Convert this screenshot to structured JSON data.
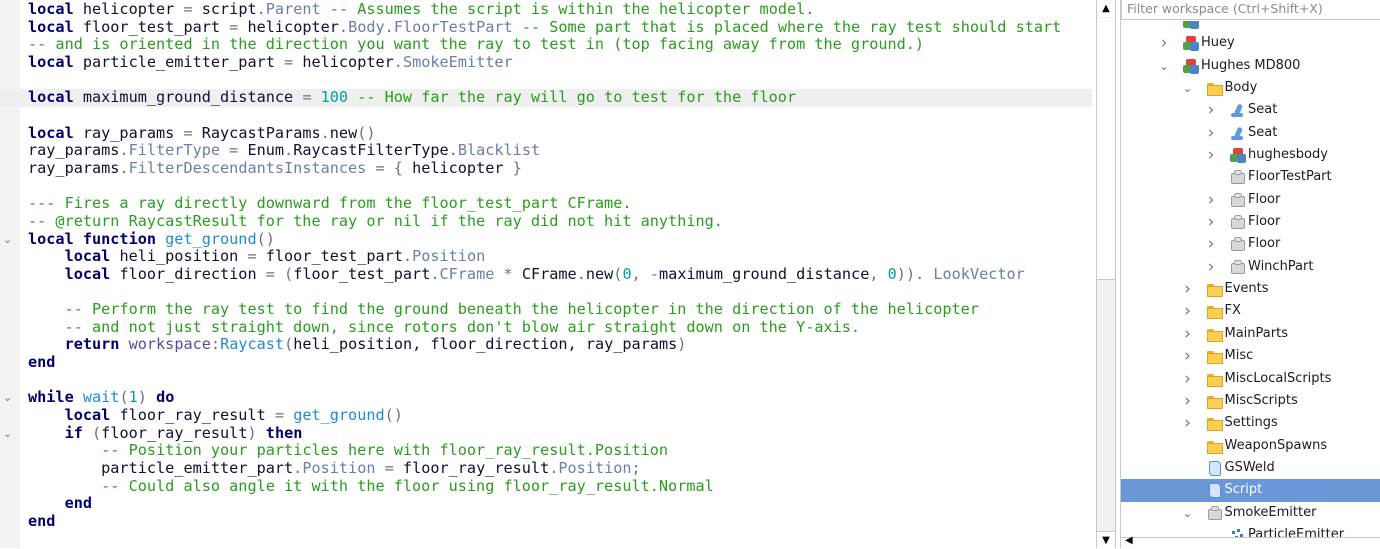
{
  "editor": {
    "highlighted_line": 6,
    "lines": [
      [
        [
          "k",
          "local"
        ],
        [
          "p",
          " helicopter "
        ],
        [
          "o",
          "="
        ],
        [
          "p",
          " script"
        ],
        [
          "o",
          "."
        ],
        [
          "m",
          "Parent"
        ],
        [
          "c",
          " -- Assumes the script is within the helicopter model."
        ]
      ],
      [
        [
          "k",
          "local"
        ],
        [
          "p",
          " floor_test_part "
        ],
        [
          "o",
          "="
        ],
        [
          "p",
          " helicopter"
        ],
        [
          "o",
          "."
        ],
        [
          "m",
          "Body"
        ],
        [
          "o",
          "."
        ],
        [
          "m",
          "FloorTestPart"
        ],
        [
          "c",
          " -- Some part that is placed where the ray test should start"
        ]
      ],
      [
        [
          "c",
          "-- and is oriented in the direction you want the ray to test in (top facing away from the ground.)"
        ]
      ],
      [
        [
          "k",
          "local"
        ],
        [
          "p",
          " particle_emitter_part "
        ],
        [
          "o",
          "="
        ],
        [
          "p",
          " helicopter"
        ],
        [
          "o",
          "."
        ],
        [
          "m",
          "SmokeEmitter"
        ]
      ],
      [],
      [
        [
          "k",
          "local"
        ],
        [
          "p",
          " maximum_ground_distance "
        ],
        [
          "o",
          "="
        ],
        [
          "n",
          " 100"
        ],
        [
          "c",
          " -- How far the ray will go to test for the floor"
        ]
      ],
      [],
      [
        [
          "k",
          "local"
        ],
        [
          "p",
          " ray_params "
        ],
        [
          "o",
          "="
        ],
        [
          "p",
          " RaycastParams"
        ],
        [
          "o",
          "."
        ],
        [
          "p",
          "new"
        ],
        [
          "o",
          "()"
        ]
      ],
      [
        [
          "p",
          "ray_params"
        ],
        [
          "o",
          "."
        ],
        [
          "m",
          "FilterType"
        ],
        [
          "o",
          " = "
        ],
        [
          "p",
          "Enum"
        ],
        [
          "o",
          "."
        ],
        [
          "p",
          "RaycastFilterType"
        ],
        [
          "o",
          "."
        ],
        [
          "m",
          "Blacklist"
        ]
      ],
      [
        [
          "p",
          "ray_params"
        ],
        [
          "o",
          "."
        ],
        [
          "m",
          "FilterDescendantsInstances"
        ],
        [
          "o",
          " = { "
        ],
        [
          "p",
          "helicopter"
        ],
        [
          "o",
          " }"
        ]
      ],
      [],
      [
        [
          "c",
          "--- Fires a ray directly downward from the floor_test_part CFrame."
        ]
      ],
      [
        [
          "c",
          "-- @return RaycastResult for the ray or nil if the ray did not hit anything."
        ]
      ],
      [
        [
          "k",
          "local function"
        ],
        [
          "f",
          " get_ground"
        ],
        [
          "o",
          "()"
        ]
      ],
      [
        [
          "p",
          "    "
        ],
        [
          "k",
          "local"
        ],
        [
          "p",
          " heli_position "
        ],
        [
          "o",
          "="
        ],
        [
          "p",
          " floor_test_part"
        ],
        [
          "o",
          "."
        ],
        [
          "m",
          "Position"
        ]
      ],
      [
        [
          "p",
          "    "
        ],
        [
          "k",
          "local"
        ],
        [
          "p",
          " floor_direction "
        ],
        [
          "o",
          "= ("
        ],
        [
          "p",
          "floor_test_part"
        ],
        [
          "o",
          "."
        ],
        [
          "m",
          "CFrame"
        ],
        [
          "o",
          " * "
        ],
        [
          "p",
          "CFrame"
        ],
        [
          "o",
          "."
        ],
        [
          "p",
          "new"
        ],
        [
          "o",
          "("
        ],
        [
          "n",
          "0"
        ],
        [
          "o",
          ", -"
        ],
        [
          "p",
          "maximum_ground_distance"
        ],
        [
          "o",
          ", "
        ],
        [
          "n",
          "0"
        ],
        [
          "o",
          ")). "
        ],
        [
          "m",
          "LookVector"
        ]
      ],
      [],
      [
        [
          "p",
          "    "
        ],
        [
          "c",
          "-- Perform the ray test to find the ground beneath the helicopter in the direction of the helicopter"
        ]
      ],
      [
        [
          "p",
          "    "
        ],
        [
          "c",
          "-- and not just straight down, since rotors don't blow air straight down on the Y-axis."
        ]
      ],
      [
        [
          "p",
          "    "
        ],
        [
          "k",
          "return"
        ],
        [
          "p",
          " "
        ],
        [
          "b",
          "workspace"
        ],
        [
          "o",
          ":"
        ],
        [
          "f",
          "Raycast"
        ],
        [
          "o",
          "("
        ],
        [
          "p",
          "heli_position, floor_direction, ray_params"
        ],
        [
          "o",
          ")"
        ]
      ],
      [
        [
          "k",
          "end"
        ]
      ],
      [],
      [
        [
          "k",
          "while"
        ],
        [
          "p",
          " "
        ],
        [
          "f",
          "wait"
        ],
        [
          "o",
          "("
        ],
        [
          "n",
          "1"
        ],
        [
          "o",
          ")"
        ],
        [
          "p",
          " "
        ],
        [
          "k",
          "do"
        ]
      ],
      [
        [
          "p",
          "    "
        ],
        [
          "k",
          "local"
        ],
        [
          "p",
          " floor_ray_result "
        ],
        [
          "o",
          "= "
        ],
        [
          "f",
          "get_ground"
        ],
        [
          "o",
          "()"
        ]
      ],
      [
        [
          "p",
          "    "
        ],
        [
          "k",
          "if"
        ],
        [
          "o",
          " ("
        ],
        [
          "p",
          "floor_ray_result"
        ],
        [
          "o",
          ")"
        ],
        [
          "p",
          " "
        ],
        [
          "k",
          "then"
        ]
      ],
      [
        [
          "p",
          "        "
        ],
        [
          "c",
          "-- Position your particles here with floor_ray_result.Position"
        ]
      ],
      [
        [
          "p",
          "        particle_emitter_part"
        ],
        [
          "o",
          "."
        ],
        [
          "m",
          "Position"
        ],
        [
          "o",
          " = "
        ],
        [
          "p",
          "floor_ray_result"
        ],
        [
          "o",
          "."
        ],
        [
          "m",
          "Position"
        ],
        [
          "o",
          ";"
        ]
      ],
      [
        [
          "p",
          "        "
        ],
        [
          "c",
          "-- Could also angle it with the floor using floor_ray_result.Normal"
        ]
      ],
      [
        [
          "p",
          "    "
        ],
        [
          "k",
          "end"
        ]
      ],
      [
        [
          "k",
          "end"
        ]
      ]
    ],
    "fold_lines": [
      14,
      23,
      25
    ]
  },
  "explorer": {
    "filter_placeholder": "Filter workspace (Ctrl+Shift+X)",
    "items": [
      {
        "label": "",
        "level": 0,
        "chevron": "none",
        "icon": "model"
      },
      {
        "label": "Huey",
        "level": 0,
        "chevron": "right",
        "icon": "model"
      },
      {
        "label": "Hughes MD800",
        "level": 0,
        "chevron": "down",
        "icon": "model"
      },
      {
        "label": "Body",
        "level": 1,
        "chevron": "down",
        "icon": "folder"
      },
      {
        "label": "Seat",
        "level": 2,
        "chevron": "right",
        "icon": "seat"
      },
      {
        "label": "Seat",
        "level": 2,
        "chevron": "right",
        "icon": "seat"
      },
      {
        "label": "hughesbody",
        "level": 2,
        "chevron": "right",
        "icon": "model"
      },
      {
        "label": "FloorTestPart",
        "level": 2,
        "chevron": "none",
        "icon": "part"
      },
      {
        "label": "Floor",
        "level": 2,
        "chevron": "right",
        "icon": "part"
      },
      {
        "label": "Floor",
        "level": 2,
        "chevron": "right",
        "icon": "part"
      },
      {
        "label": "Floor",
        "level": 2,
        "chevron": "right",
        "icon": "part"
      },
      {
        "label": "WinchPart",
        "level": 2,
        "chevron": "right",
        "icon": "part"
      },
      {
        "label": "Events",
        "level": 1,
        "chevron": "right",
        "icon": "folder"
      },
      {
        "label": "FX",
        "level": 1,
        "chevron": "right",
        "icon": "folder"
      },
      {
        "label": "MainParts",
        "level": 1,
        "chevron": "right",
        "icon": "folder"
      },
      {
        "label": "Misc",
        "level": 1,
        "chevron": "right",
        "icon": "folder"
      },
      {
        "label": "MiscLocalScripts",
        "level": 1,
        "chevron": "right",
        "icon": "folder"
      },
      {
        "label": "MiscScripts",
        "level": 1,
        "chevron": "right",
        "icon": "folder"
      },
      {
        "label": "Settings",
        "level": 1,
        "chevron": "right",
        "icon": "folder"
      },
      {
        "label": "WeaponSpawns",
        "level": 1,
        "chevron": "none",
        "icon": "folder"
      },
      {
        "label": "GSWeld",
        "level": 1,
        "chevron": "none",
        "icon": "script"
      },
      {
        "label": "Script",
        "level": 1,
        "chevron": "none",
        "icon": "script",
        "selected": true
      },
      {
        "label": "SmokeEmitter",
        "level": 1,
        "chevron": "down",
        "icon": "part"
      },
      {
        "label": "ParticleEmitter",
        "level": 2,
        "chevron": "none",
        "icon": "emitter"
      }
    ]
  },
  "colors": {
    "selection": "#6a97d8",
    "comment": "#2a9d1e",
    "keyword": "#00006e",
    "number": "#00a0a8"
  }
}
